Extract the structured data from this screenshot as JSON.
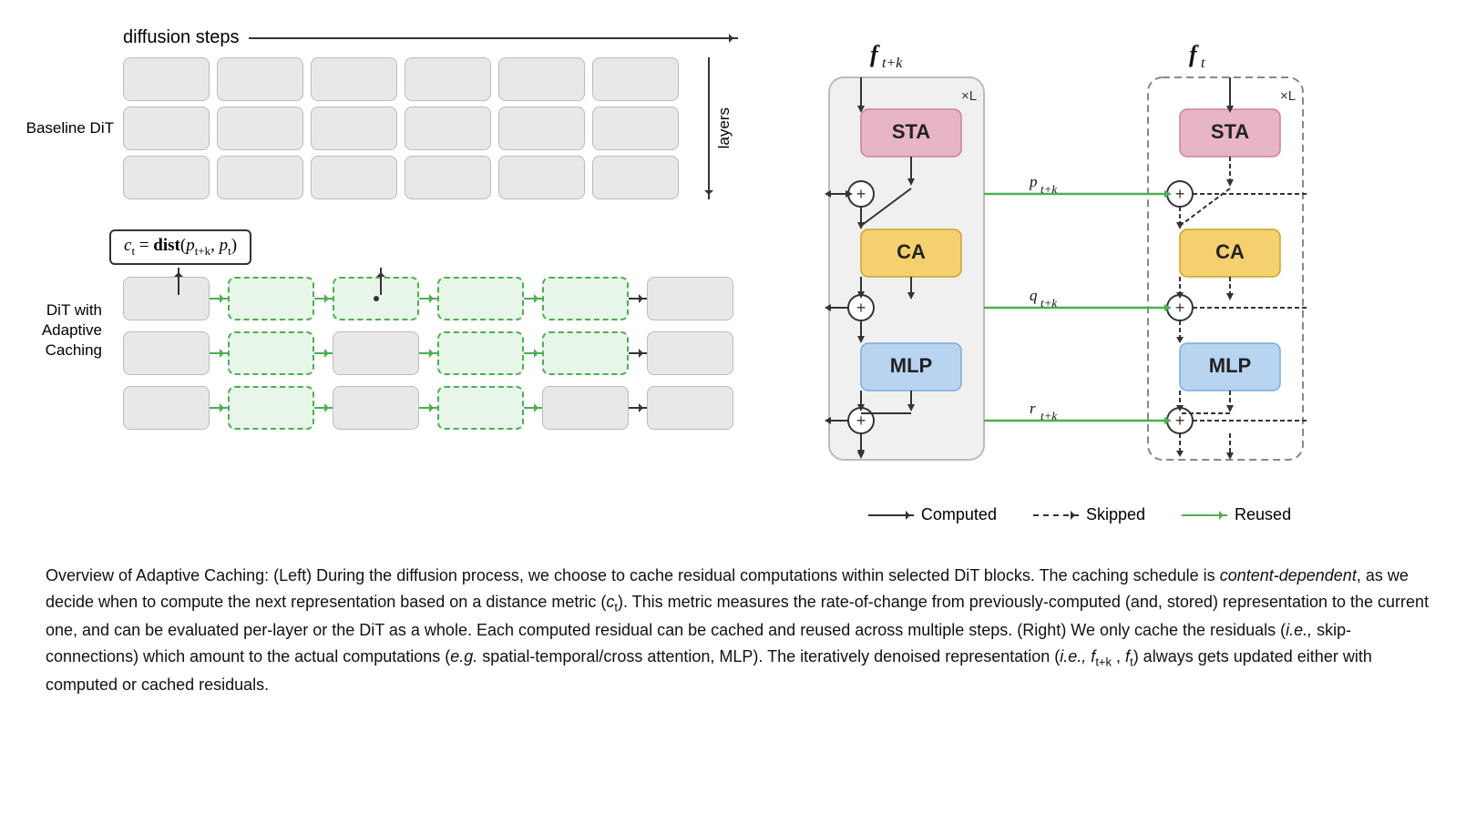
{
  "header": {
    "diffusion_steps": "diffusion steps",
    "layers": "layers"
  },
  "left_panel": {
    "baseline_label": "Baseline DiT",
    "adaptive_label": "DiT with\nAdaptive Caching",
    "formula": "c_t = dist(p_{t+k}, p_t)"
  },
  "right_panel": {
    "f_tk_label": "f",
    "f_tk_sub": "t+k",
    "f_t_label": "f",
    "f_t_sub": "t",
    "multiply": "×L",
    "blocks": {
      "sta": "STA",
      "ca": "CA",
      "mlp": "MLP"
    },
    "arrows": {
      "p_label": "p_{t+k}",
      "q_label": "q_{t+k}",
      "r_label": "r_{t+k}"
    }
  },
  "legend": {
    "computed": "Computed",
    "skipped": "Skipped",
    "reused": "Reused"
  },
  "caption": {
    "text": "Overview of Adaptive Caching: (Left) During the diffusion process, we choose to cache residual computations within selected DiT blocks. The caching schedule is content-dependent, as we decide when to compute the next representation based on a distance metric (ct). This metric measures the rate-of-change from previously-computed (and, stored) representation to the current one, and can be evaluated per-layer or the DiT as a whole. Each computed residual can be cached and reused across multiple steps. (Right) We only cache the residuals (i.e., skip-connections) which amount to the actual computations (e.g. spatial-temporal/cross attention, MLP). The iteratively denoised representation (i.e., ft+k , ft) always gets updated either with computed or cached residuals."
  }
}
